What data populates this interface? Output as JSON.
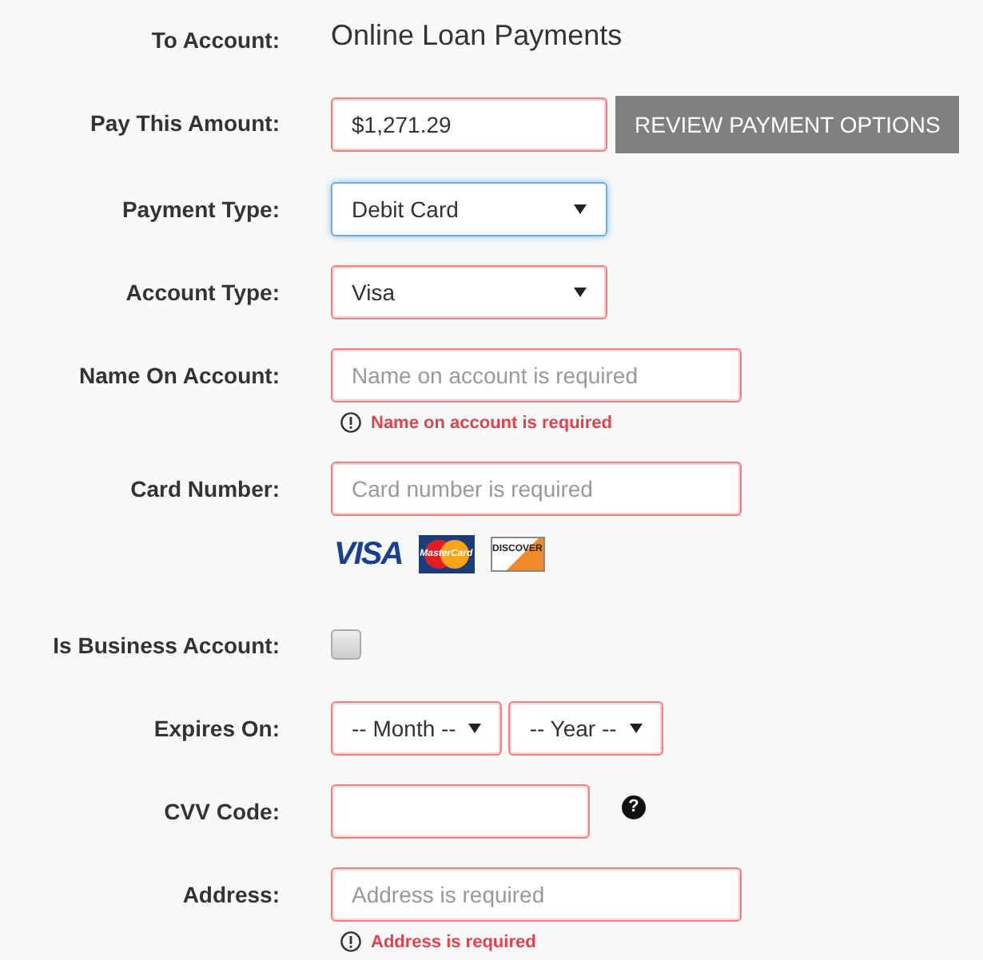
{
  "rows": [
    {
      "kind": "static",
      "label": "To Account:",
      "value": "Online Loan Payments"
    },
    {
      "kind": "amount",
      "label": "Pay This Amount:",
      "value": "$1,271.29",
      "invalid": true,
      "button": "REVIEW PAYMENT OPTIONS"
    },
    {
      "kind": "select",
      "label": "Payment Type:",
      "value": "Debit Card",
      "invalid": false,
      "focused": true
    },
    {
      "kind": "select",
      "label": "Account Type:",
      "value": "Visa",
      "invalid": true,
      "focused": false
    },
    {
      "kind": "text",
      "label": "Name On Account:",
      "placeholder": "Name on account is required",
      "invalid": true,
      "error": "Name on account is required"
    },
    {
      "kind": "text",
      "label": "Card Number:",
      "placeholder": "Card number is required",
      "invalid": true
    },
    {
      "kind": "cards",
      "cards": [
        {
          "kind": "visa",
          "label": "VISA"
        },
        {
          "kind": "mastercard",
          "label": "MasterCard"
        },
        {
          "kind": "discover",
          "label": "DISCOVER"
        }
      ]
    },
    {
      "kind": "checkbox",
      "label": "Is Business Account:",
      "checked": false
    },
    {
      "kind": "expiry",
      "label": "Expires On:",
      "month": "-- Month --",
      "year": "-- Year --",
      "invalid": true
    },
    {
      "kind": "cvv",
      "label": "CVV Code:",
      "invalid": true,
      "help": "?"
    },
    {
      "kind": "text",
      "label": "Address:",
      "placeholder": "Address is required",
      "invalid": true,
      "error": "Address is required"
    }
  ]
}
